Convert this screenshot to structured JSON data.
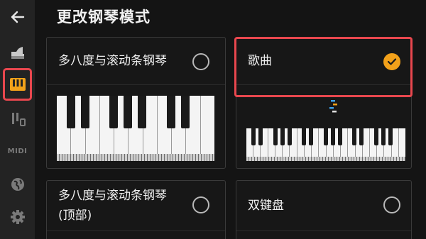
{
  "header": {
    "title": "更改钢琴模式"
  },
  "sidebar": {
    "items": [
      {
        "name": "back-arrow-icon"
      },
      {
        "name": "grand-piano-icon"
      },
      {
        "name": "keyboard-icon",
        "selected": true
      },
      {
        "name": "mixer-icon"
      },
      {
        "name": "midi-icon",
        "label": "MIDI"
      },
      {
        "name": "earth-icon"
      },
      {
        "name": "gear-icon"
      }
    ]
  },
  "modes": [
    {
      "label": "多八度与滚动条钢琴",
      "selected": false
    },
    {
      "label": "歌曲",
      "selected": true
    },
    {
      "label": "多八度与滚动条钢琴\n(顶部)",
      "label_line1": "多八度与滚动条钢琴",
      "label_line2": "(顶部)",
      "selected": false
    },
    {
      "label": "双键盘",
      "selected": false
    }
  ],
  "colors": {
    "accent": "#f2a11a",
    "highlight": "#e8474e",
    "background": "#141414",
    "sidebar": "#232323"
  }
}
